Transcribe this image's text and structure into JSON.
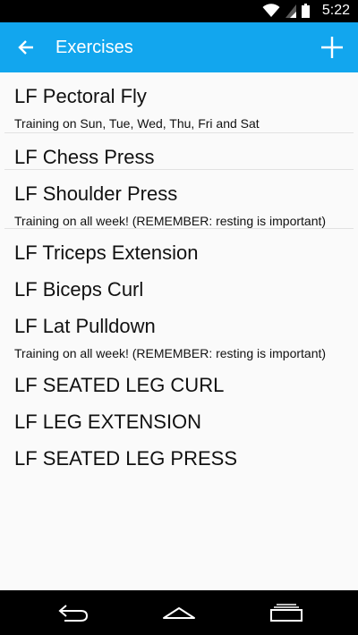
{
  "status_bar": {
    "time": "5:22"
  },
  "app_bar": {
    "title": "Exercises"
  },
  "exercises": [
    {
      "name": "LF Pectoral Fly",
      "schedule": "Training on  Sun, Tue, Wed, Thu, Fri and Sat"
    },
    {
      "name": "LF Chess Press",
      "schedule": ""
    },
    {
      "name": "LF Shoulder Press",
      "schedule": "Training on  all week! (REMEMBER: resting is important)"
    },
    {
      "name": "LF Triceps Extension",
      "schedule": ""
    },
    {
      "name": "LF Biceps Curl",
      "schedule": ""
    },
    {
      "name": "LF Lat Pulldown",
      "schedule": "Training on  all week! (REMEMBER: resting is important)"
    },
    {
      "name": "LF SEATED LEG CURL",
      "schedule": ""
    },
    {
      "name": "LF LEG EXTENSION",
      "schedule": ""
    },
    {
      "name": "LF SEATED LEG PRESS",
      "schedule": ""
    }
  ],
  "colors": {
    "app_bar": "#12a6ee",
    "background": "#fafafa",
    "status_bar": "#000000",
    "nav_bar": "#000000"
  },
  "icons": [
    "wifi-icon",
    "signal-icon",
    "battery-icon",
    "back-arrow-icon",
    "add-icon",
    "nav-back-icon",
    "nav-home-icon",
    "nav-recents-icon"
  ]
}
